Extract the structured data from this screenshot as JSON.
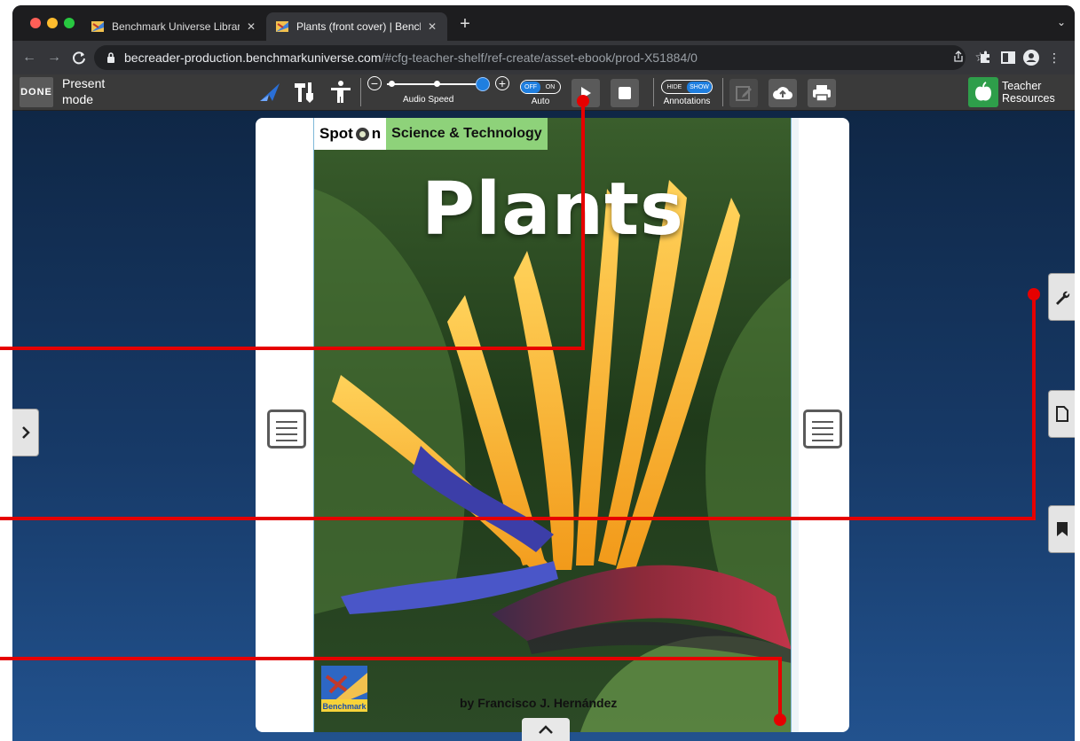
{
  "browser": {
    "tabs": [
      {
        "title": "Benchmark Universe Library",
        "active": false
      },
      {
        "title": "Plants (front cover) | Benchmark",
        "active": true
      }
    ],
    "new_tab_label": "+",
    "tab_menu_label": "⌄",
    "url_host": "becreader-production.benchmarkuniverse.com",
    "url_path": "/#cfg-teacher-shelf/ref-create/asset-ebook/prod-X51884/0"
  },
  "reader": {
    "done_label": "DONE",
    "present_mode_label": "Present mode",
    "audio_speed_label": "Audio Speed",
    "auto_toggle": {
      "off": "OFF",
      "on": "ON",
      "caption": "Auto"
    },
    "annotations_toggle": {
      "hide": "HIDE",
      "show": "SHOW",
      "caption": "Annotations"
    },
    "teacher_resources_label": "Teacher Resources"
  },
  "book": {
    "series_name_part1": "Spot",
    "series_name_part2": "n",
    "subject": "Science & Technology",
    "title": "Plants",
    "author": "by Francisco J. Hernández",
    "publisher_logo_text": "Benchmark"
  },
  "colors": {
    "accent_blue": "#1f7fe0",
    "annotation_red": "#e60000",
    "apple_green": "#2e9e4a",
    "subject_green": "#8ed27a"
  }
}
